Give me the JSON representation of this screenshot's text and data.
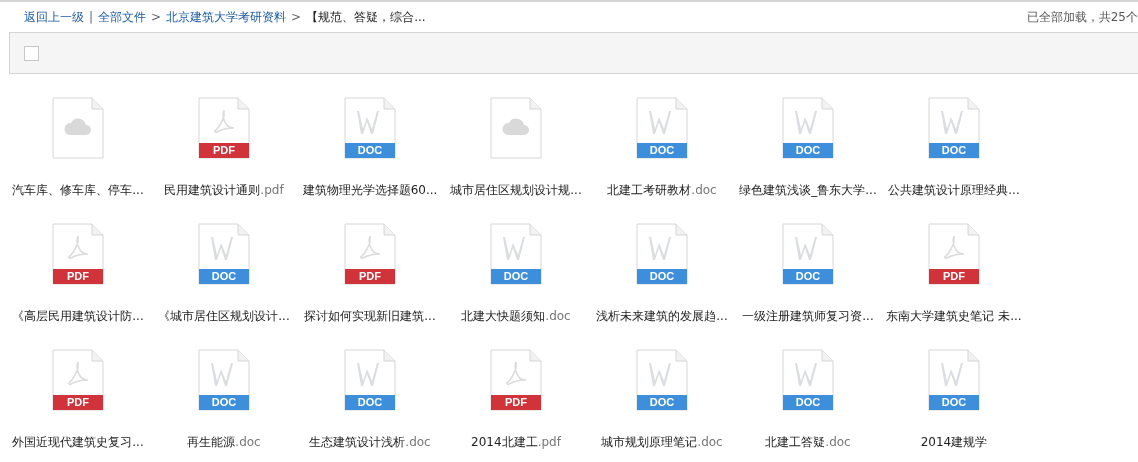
{
  "breadcrumb": [
    {
      "text": "返回上一级",
      "kind": "link"
    },
    {
      "text": "|",
      "kind": "sep"
    },
    {
      "text": "全部文件",
      "kind": "link"
    },
    {
      "text": ">",
      "kind": "sep"
    },
    {
      "text": "北京建筑大学考研资料",
      "kind": "link"
    },
    {
      "text": ">",
      "kind": "sep"
    },
    {
      "text": "【规范、答疑，综合...",
      "kind": "current"
    }
  ],
  "load_status": "已全部加载，共25个",
  "toolbar": {
    "select_all_checked": false
  },
  "files": [
    {
      "kind": "cloud",
      "name": "汽车库、修车库、停车..."
    },
    {
      "kind": "pdf",
      "badge": "PDF",
      "name": "民用建筑设计通则",
      "ext": ".pdf"
    },
    {
      "kind": "doc",
      "badge": "DOC",
      "name": "建筑物理光学选择题60..."
    },
    {
      "kind": "cloud",
      "name": "城市居住区规划设计规..."
    },
    {
      "kind": "doc",
      "badge": "DOC",
      "name": "北建工考研教材",
      "ext": ".doc"
    },
    {
      "kind": "doc",
      "badge": "DOC",
      "name": "绿色建筑浅谈_鲁东大学..."
    },
    {
      "kind": "doc",
      "badge": "DOC",
      "name": "公共建筑设计原理经典..."
    },
    {
      "kind": "pdf",
      "badge": "PDF",
      "name": "《高层民用建筑设计防..."
    },
    {
      "kind": "doc",
      "badge": "DOC",
      "name": "《城市居住区规划设计..."
    },
    {
      "kind": "pdf",
      "badge": "PDF",
      "name": "探讨如何实现新旧建筑..."
    },
    {
      "kind": "doc",
      "badge": "DOC",
      "name": "北建大快题须知",
      "ext": ".doc"
    },
    {
      "kind": "doc",
      "badge": "DOC",
      "name": "浅析未来建筑的发展趋..."
    },
    {
      "kind": "doc",
      "badge": "DOC",
      "name": "一级注册建筑师复习资..."
    },
    {
      "kind": "pdf",
      "badge": "PDF",
      "name": "东南大学建筑史笔记 未..."
    },
    {
      "kind": "pdf",
      "badge": "PDF",
      "name": "外国近现代建筑史复习..."
    },
    {
      "kind": "doc",
      "badge": "DOC",
      "name": "再生能源",
      "ext": ".doc"
    },
    {
      "kind": "doc",
      "badge": "DOC",
      "name": "生态建筑设计浅析",
      "ext": ".doc"
    },
    {
      "kind": "pdf",
      "badge": "PDF",
      "name": "2014北建工",
      "ext": ".pdf"
    },
    {
      "kind": "doc",
      "badge": "DOC",
      "name": "城市规划原理笔记",
      "ext": ".doc"
    },
    {
      "kind": "doc",
      "badge": "DOC",
      "name": "北建工答疑",
      "ext": ".doc"
    },
    {
      "kind": "doc",
      "badge": "DOC",
      "name": "2014建规学"
    }
  ]
}
